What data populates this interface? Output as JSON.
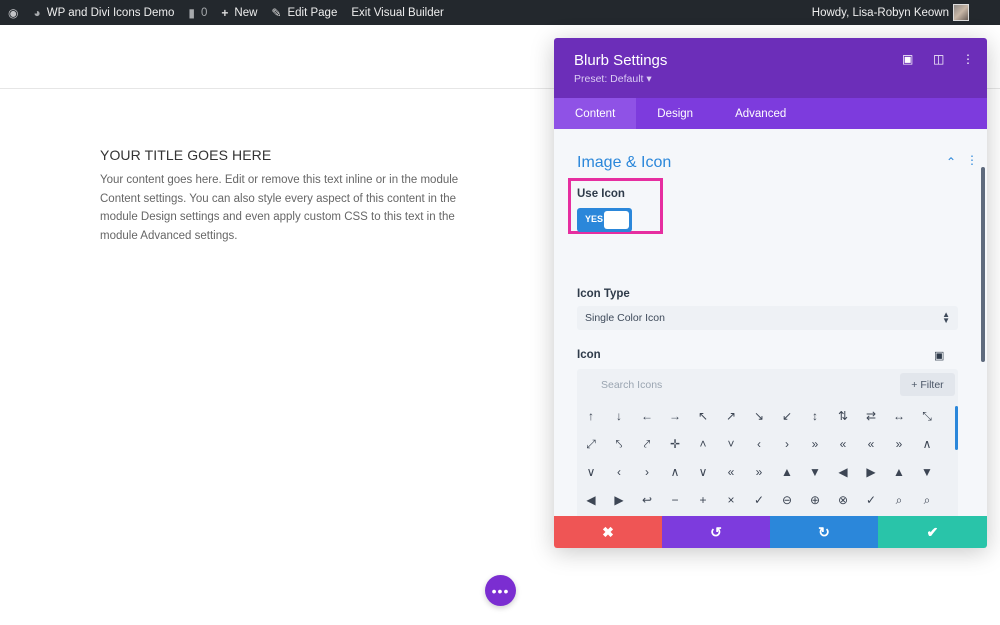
{
  "adminbar": {
    "site_name": "WP and Divi Icons Demo",
    "comments_count": "0",
    "new_label": "New",
    "edit_page_label": "Edit Page",
    "exit_label": "Exit Visual Builder",
    "greeting": "Howdy, Lisa-Robyn Keown",
    "icons": {
      "wordpress": "wordpress-icon",
      "site": "dashboard-icon",
      "comments": "comment-icon",
      "new": "plus-icon",
      "edit": "pencil-icon"
    }
  },
  "page": {
    "module_title": "YOUR TITLE GOES HERE",
    "module_body": "Your content goes here. Edit or remove this text inline or in the module Content settings. You can also style every aspect of this content in the module Design settings and even apply custom CSS to this text in the module Advanced settings."
  },
  "modal": {
    "title": "Blurb Settings",
    "preset": "Preset: Default ▾",
    "tabs": [
      {
        "label": "Content",
        "active": true
      },
      {
        "label": "Design",
        "active": false
      },
      {
        "label": "Advanced",
        "active": false
      }
    ],
    "section_title": "Image & Icon",
    "use_icon_label": "Use Icon",
    "toggle_value": "YES",
    "icon_type_label": "Icon Type",
    "icon_type_value": "Single Color Icon",
    "icon_label": "Icon",
    "search_placeholder": "Search Icons",
    "filter_label": "+ Filter",
    "icon_rows": [
      [
        "↑",
        "↓",
        "←",
        "→",
        "↖",
        "↗",
        "↘",
        "↙",
        "↕",
        "⇅",
        "⇄",
        "↔",
        "⤡"
      ],
      [
        "⤢",
        "⤣",
        "⤤",
        "✛",
        "˄",
        "˅",
        "‹",
        "›",
        "»",
        "«",
        "«",
        "»",
        "∧"
      ],
      [
        "∨",
        "‹",
        "›",
        "∧",
        "∨",
        "«",
        "»",
        "▲",
        "▼",
        "◀",
        "▶",
        "▲",
        "▼"
      ],
      [
        "◀",
        "▶",
        "↩",
        "−",
        "+",
        "×",
        "✓",
        "⊖",
        "⊕",
        "⊗",
        "✓",
        "⌕",
        "⌕"
      ],
      [
        "⌕",
        "□",
        "▣",
        "⊟",
        "⊞",
        "☑",
        "○",
        "◉",
        "◉",
        "▪",
        "⏸",
        "‖",
        "≡"
      ]
    ],
    "footer": {
      "cancel": "✖",
      "undo": "↺",
      "redo": "↻",
      "save": "✔"
    }
  },
  "colors": {
    "header_purple": "#6c2eb9",
    "tab_purple": "#7d3bdd",
    "accent_blue": "#2b87da",
    "highlight_pink": "#e62ea0",
    "cancel_red": "#ef5555",
    "save_green": "#29c4a9"
  }
}
